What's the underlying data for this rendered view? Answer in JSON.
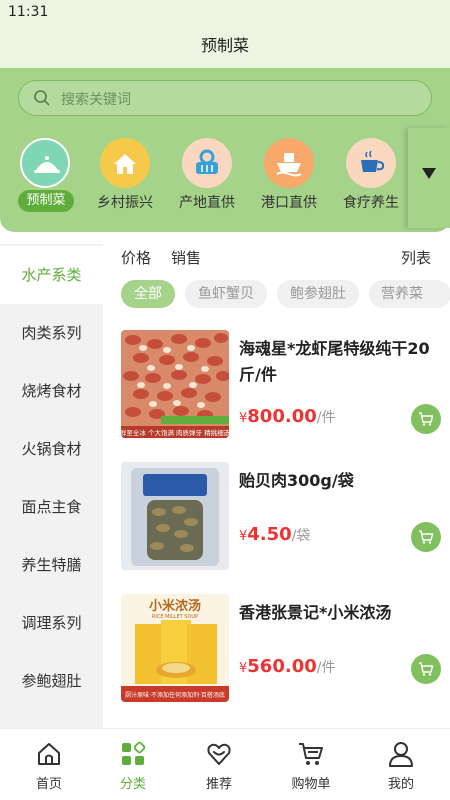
{
  "status": {
    "time": "11:31"
  },
  "header": {
    "title": "预制菜"
  },
  "search": {
    "placeholder": "搜索关键词",
    "icon": "search-icon"
  },
  "categories": [
    {
      "label": "预制菜",
      "icon": "dish-cover-icon",
      "color": "#7ed6b4",
      "active": true
    },
    {
      "label": "乡村振兴",
      "icon": "village-house-icon",
      "color": "#f7c94a"
    },
    {
      "label": "产地直供",
      "icon": "basket-icon",
      "color": "#fad7bf"
    },
    {
      "label": "港口直供",
      "icon": "ship-icon",
      "color": "#f9a86b"
    },
    {
      "label": "食疗养生",
      "icon": "tea-cup-icon",
      "color": "#fad7bf"
    }
  ],
  "expand_icon": "triangle-down-icon",
  "sidebar": {
    "items": [
      {
        "label": "水产系类",
        "active": true
      },
      {
        "label": "肉类系列"
      },
      {
        "label": "烧烤食材"
      },
      {
        "label": "火锅食材"
      },
      {
        "label": "面点主食"
      },
      {
        "label": "养生特膳"
      },
      {
        "label": "调理系列"
      },
      {
        "label": "参鲍翅肚"
      }
    ]
  },
  "sort": {
    "price": "价格",
    "sales": "销售",
    "view": "列表"
  },
  "tags": [
    {
      "label": "全部",
      "active": true
    },
    {
      "label": "鱼虾蟹贝"
    },
    {
      "label": "鲍参翅肚"
    },
    {
      "label": "营养菜"
    }
  ],
  "products": [
    {
      "name": "海魂星*龙虾尾特级纯干20斤/件",
      "currency": "¥",
      "price": "800.00",
      "unit": "/件",
      "image": "lobster-tails-photo"
    },
    {
      "name": "贻贝肉300g/袋",
      "currency": "¥",
      "price": "4.50",
      "unit": "/袋",
      "image": "mussel-meat-bag-photo"
    },
    {
      "name": "香港张景记*小米浓汤",
      "currency": "¥",
      "price": "560.00",
      "unit": "/件",
      "image": "millet-soup-package-photo"
    }
  ],
  "product_image_text": {
    "lobster": "鲜至全冰 个大饱满 肉质弹牙 精挑细选",
    "soup_title": "小米浓汤",
    "soup_en": "RICE MILLET SOUP",
    "soup_caption": "厨汁原味·不添加任何添加剂·百搭汤底"
  },
  "tabbar": [
    {
      "label": "首页",
      "icon": "home-icon"
    },
    {
      "label": "分类",
      "icon": "category-grid-icon",
      "active": true
    },
    {
      "label": "推荐",
      "icon": "recommend-heart-icon"
    },
    {
      "label": "购物单",
      "icon": "shopping-cart-icon"
    },
    {
      "label": "我的",
      "icon": "user-profile-icon"
    }
  ],
  "colors": {
    "accent": "#5fae3b",
    "price": "#e33333",
    "top_bg": "#a5d38a",
    "header_bg": "#eaf5e2"
  }
}
